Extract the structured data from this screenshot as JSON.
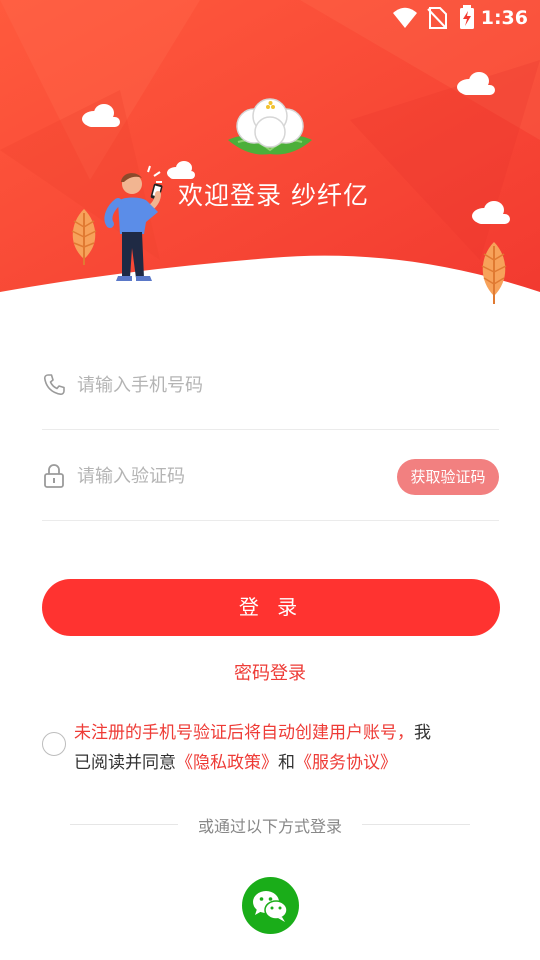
{
  "status_bar": {
    "time": "1:36"
  },
  "header": {
    "welcome_text": "欢迎登录 纱纤亿"
  },
  "login_form": {
    "phone_placeholder": "请输入手机号码",
    "code_placeholder": "请输入验证码",
    "get_code_label": "获取验证码",
    "login_label": "登 录",
    "password_login_label": "密码登录"
  },
  "agreement": {
    "checked": false,
    "notice": "未注册的手机号验证后将自动创建用户账号，",
    "text_1": "我",
    "text_2": "已阅读并同意",
    "privacy_link": "《隐私政策》",
    "and": "和",
    "service_link": "《服务协议》"
  },
  "alt_login": {
    "label": "或通过以下方式登录",
    "methods": [
      "wechat-icon"
    ]
  },
  "colors": {
    "primary": "#ff3330",
    "code_button": "#f28080",
    "link": "#ee3b36",
    "wechat": "#1aad19"
  }
}
